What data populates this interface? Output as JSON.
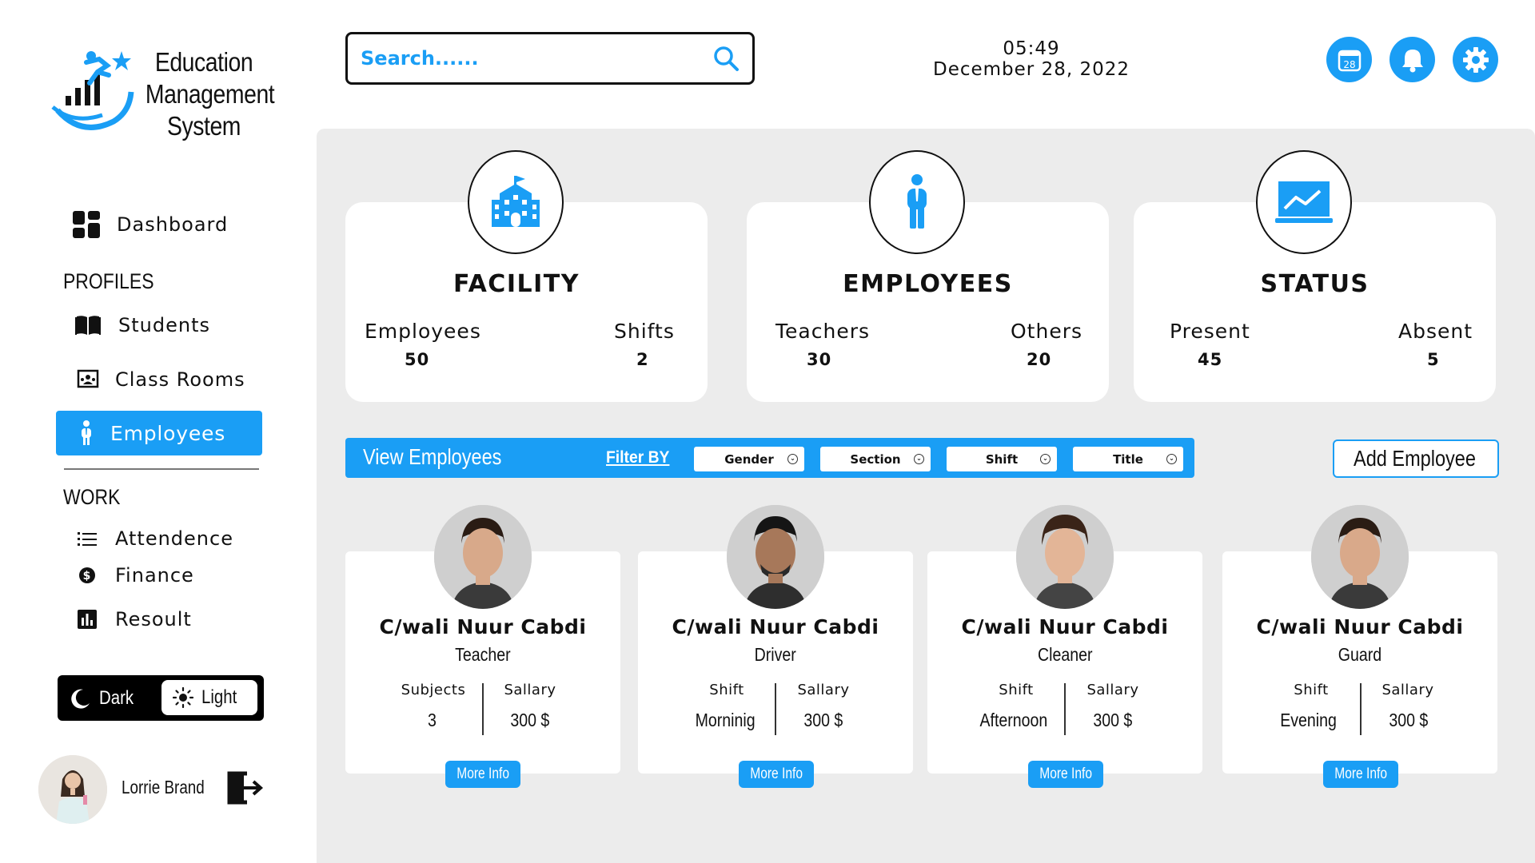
{
  "app": {
    "title_line1": "Education",
    "title_line2": "Management",
    "title_line3": "System"
  },
  "colors": {
    "accent": "#1a9ef5",
    "panel": "#ececec",
    "card": "#ffffff",
    "text": "#111111"
  },
  "sidebar": {
    "dashboard": "Dashboard",
    "profiles_label": "PROFILES",
    "students": "Students",
    "class_rooms": "Class Rooms",
    "employees": "Employees",
    "work_label": "WORK",
    "attendance": "Attendence",
    "finance": "Finance",
    "result": "Resoult",
    "theme": {
      "dark": "Dark",
      "light": "Light"
    },
    "user": {
      "name": "Lorrie Brand"
    }
  },
  "header": {
    "search_placeholder": "Search......",
    "time": "05:49",
    "date": "December 28, 2022",
    "calendar_day": "28",
    "icons": [
      "calendar-icon",
      "bell-icon",
      "gear-icon"
    ]
  },
  "stats": [
    {
      "title": "FACILITY",
      "icon": "school-building-icon",
      "left_label": "Employees",
      "left_value": "50",
      "right_label": "Shifts",
      "right_value": "2"
    },
    {
      "title": "EMPLOYEES",
      "icon": "person-icon",
      "left_label": "Teachers",
      "left_value": "30",
      "right_label": "Others",
      "right_value": "20"
    },
    {
      "title": "STATUS",
      "icon": "chart-monitor-icon",
      "left_label": "Present",
      "left_value": "45",
      "right_label": "Absent",
      "right_value": "5"
    }
  ],
  "filters": {
    "title": "View Employees",
    "filter_by": "Filter BY",
    "options": [
      "Gender",
      "Section",
      "Shift",
      "Title"
    ],
    "add_button": "Add Employee"
  },
  "employees": [
    {
      "name": "C/wali Nuur Cabdi",
      "role": "Teacher",
      "k1": "Subjects",
      "v1": "3",
      "k2": "Sallary",
      "v2": "300 $",
      "button": "More Info"
    },
    {
      "name": "C/wali Nuur Cabdi",
      "role": "Driver",
      "k1": "Shift",
      "v1": "Morninig",
      "k2": "Sallary",
      "v2": "300 $",
      "button": "More Info"
    },
    {
      "name": "C/wali Nuur Cabdi",
      "role": "Cleaner",
      "k1": "Shift",
      "v1": "Afternoon",
      "k2": "Sallary",
      "v2": "300 $",
      "button": "More Info"
    },
    {
      "name": "C/wali Nuur Cabdi",
      "role": "Guard",
      "k1": "Shift",
      "v1": "Evening",
      "k2": "Sallary",
      "v2": "300 $",
      "button": "More Info"
    }
  ]
}
